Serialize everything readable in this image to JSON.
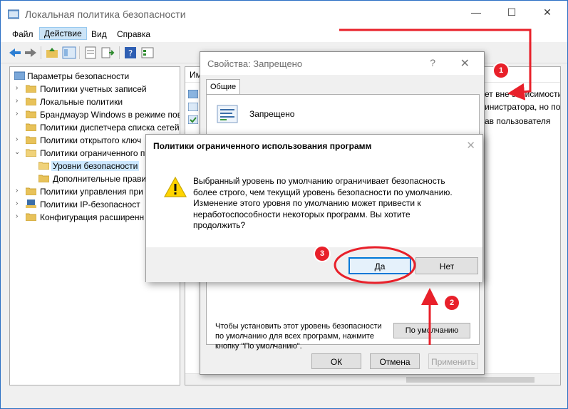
{
  "window": {
    "title": "Локальная политика безопасности"
  },
  "menu": [
    "Файл",
    "Действие",
    "Вид",
    "Справка"
  ],
  "tree": {
    "root": "Параметры безопасности",
    "items": [
      "Политики учетных записей",
      "Локальные политики",
      "Брандмауэр Windows в режиме пов",
      "Политики диспетчера списка сетей",
      "Политики открытого ключ",
      "Политики ограниченного п",
      "Уровни безопасности",
      "Дополнительные прави",
      "Политики управления при",
      "Политики IP-безопасност",
      "Конфигурация расширенн"
    ]
  },
  "right_pane": {
    "header": "Им",
    "lines": [
      "ет вне зависимости",
      "инистратора, но по",
      "ав пользователя"
    ]
  },
  "properties": {
    "title": "Свойства: Запрещено",
    "help": "?",
    "tab": "Общие",
    "item_label": "Запрещено",
    "desc": "Чтобы установить этот уровень безопасности по умолчанию для всех программ, нажмите кнопку \"По умолчанию\".",
    "default_button": "По умолчанию",
    "ok": "ОК",
    "cancel": "Отмена",
    "apply": "Применить"
  },
  "message": {
    "title": "Политики ограниченного использования программ",
    "text": "Выбранный уровень по умолчанию ограничивает безопасность более строго, чем текущий уровень безопасности по умолчанию. Изменение этого уровня по умолчанию может привести к неработоспособности некоторых программ. Вы хотите продолжить?",
    "yes": "Да",
    "no": "Нет"
  },
  "annotations": {
    "badge1": "1",
    "badge2": "2",
    "badge3": "3",
    "color": "#e8202a"
  },
  "colors": {
    "accent": "#0078d7",
    "selection": "#cde8ff",
    "frame": "#2b6fc4"
  }
}
